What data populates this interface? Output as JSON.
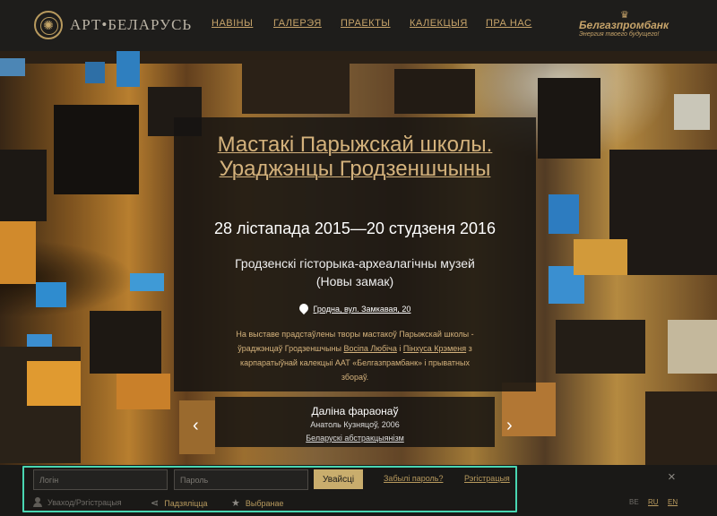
{
  "header": {
    "logo_text": "АРТ•БЕЛАРУСЬ",
    "nav": [
      "НАВІНЫ",
      "ГАЛЕРЭЯ",
      "ПРАЕКТЫ",
      "КАЛЕКЦЫЯ",
      "ПРА НАС"
    ],
    "sponsor": {
      "name": "Белгазпромбанк",
      "slogan": "Энергия твоего будущего!"
    }
  },
  "exhibition": {
    "title": "Мастакі Парыжскай школы. Ураджэнцы Гродзеншчыны",
    "dates": "28 лістапада 2015—20 студзеня 2016",
    "venue_line1": "Гродзенскі гісторыка-археалагічны музей",
    "venue_line2": "(Новы замак)",
    "address": "Гродна, вул. Замкавая, 20",
    "desc_part1": "На выставе прадстаўлены творы мастакоў Парыжскай школы - ўраджэнцаў Гродзеншчыны ",
    "desc_link1": "Восіпа Любіча",
    "desc_part2": " і ",
    "desc_link2": "Пінхуса Крэменя",
    "desc_part3": " з карпаратыўнай калекцыі ААТ «Белгазпрамбанк» і прыватных збораў."
  },
  "artwork": {
    "title": "Даліна фараонаў",
    "author": "Анатоль Кузняцоў, 2006",
    "collection_link": "Беларускі абстракцыянізм",
    "prev_symbol": "‹",
    "next_symbol": "›"
  },
  "footer": {
    "login_placeholder": "Логін",
    "password_placeholder": "Пароль",
    "login_button": "Увайсці",
    "forgot_password": "Забылі пароль?",
    "register": "Рэгістрацыя",
    "login_register": "Уваход/Рэгістрацыя",
    "share": "Падзяліцца",
    "favorites": "Выбранае",
    "close_symbol": "×",
    "languages": [
      "BE",
      "RU",
      "EN"
    ]
  },
  "colors": {
    "accent": "#c7a46a",
    "focus_outline": "#49d6b2",
    "button": "#c9ad6d"
  }
}
